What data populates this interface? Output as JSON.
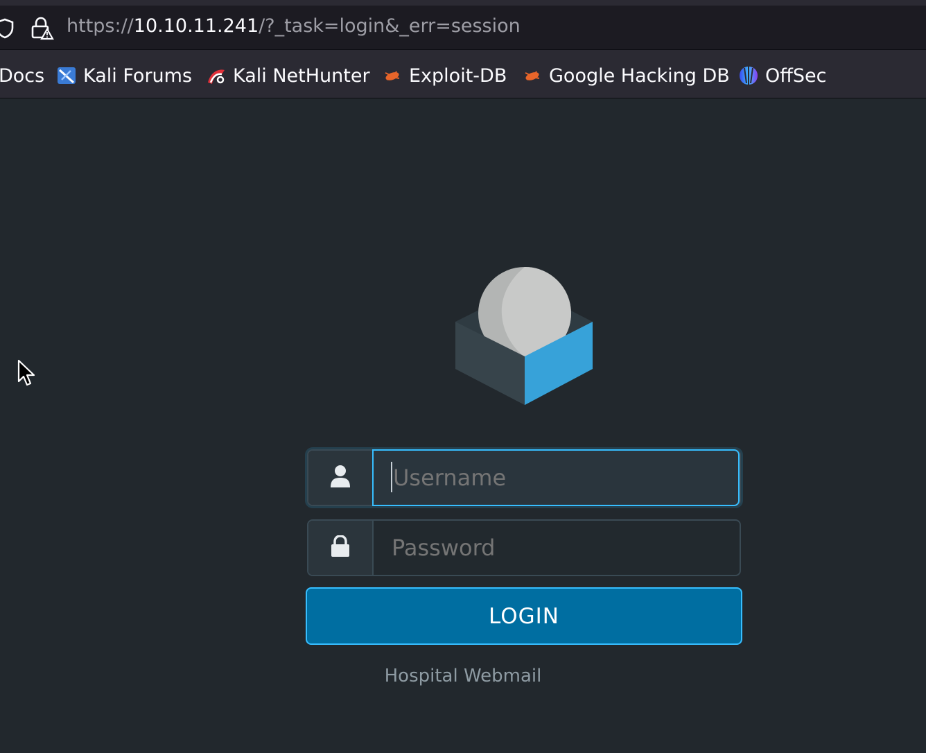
{
  "browser": {
    "url": {
      "scheme": "https://",
      "host": "10.10.11.241",
      "path": "/?_task=login&_err=session"
    },
    "bookmarks": [
      {
        "label": "Docs",
        "icon": "none"
      },
      {
        "label": "Kali Forums",
        "icon": "kali-forums-icon"
      },
      {
        "label": "Kali NetHunter",
        "icon": "kali-nethunter-icon"
      },
      {
        "label": "Exploit-DB",
        "icon": "exploit-db-icon"
      },
      {
        "label": "Google Hacking DB",
        "icon": "exploit-db-icon"
      },
      {
        "label": "OffSec",
        "icon": "offsec-icon"
      }
    ]
  },
  "login": {
    "username_placeholder": "Username",
    "password_placeholder": "Password",
    "submit_label": "LOGIN",
    "product_name": "Hospital Webmail"
  },
  "colors": {
    "background": "#22282d",
    "accent": "#37beff",
    "button": "#006ea1"
  }
}
